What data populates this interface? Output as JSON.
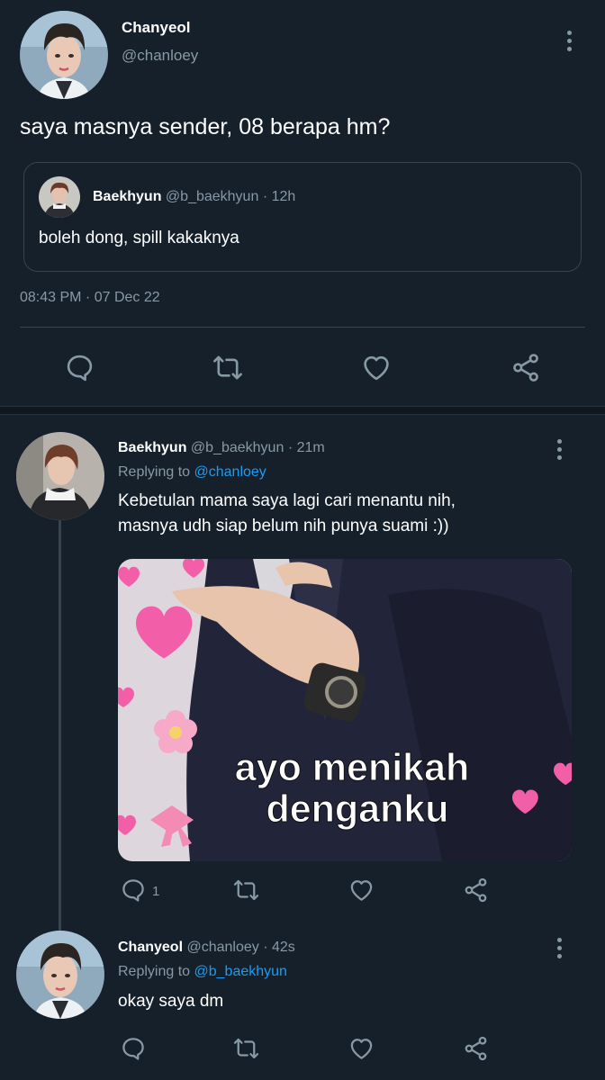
{
  "main_tweet": {
    "display_name": "Chanyeol",
    "handle": "@chanloey",
    "text": "saya masnya sender, 08 berapa hm?",
    "timestamp": "08:43 PM · 07 Dec 22",
    "quoted": {
      "display_name": "Baekhyun",
      "handle": "@b_baekhyun",
      "time": "· 12h",
      "text": "boleh dong, spill kakaknya"
    },
    "actions": [
      "reply-icon",
      "retweet-icon",
      "like-icon",
      "share-icon"
    ]
  },
  "replies": [
    {
      "display_name": "Baekhyun",
      "handle": "@b_baekhyun",
      "time": "· 21m",
      "replying_prefix": "Replying to",
      "replying_to": "@chanloey",
      "text_line1": "Kebetulan mama saya lagi cari menantu nih,",
      "text_line2": "masnya udh siap belum nih punya suami :))",
      "image_caption_line1": "ayo menikah",
      "image_caption_line2": "denganku",
      "reply_count": "1"
    },
    {
      "display_name": "Chanyeol",
      "handle": "@chanloey",
      "time": "· 42s",
      "replying_prefix": "Replying to",
      "replying_to": "@b_baekhyun",
      "text": "okay saya dm"
    }
  ],
  "colors": {
    "background": "#15202b",
    "muted": "#8899a6",
    "link": "#1d9bf0",
    "border": "#38444d"
  }
}
